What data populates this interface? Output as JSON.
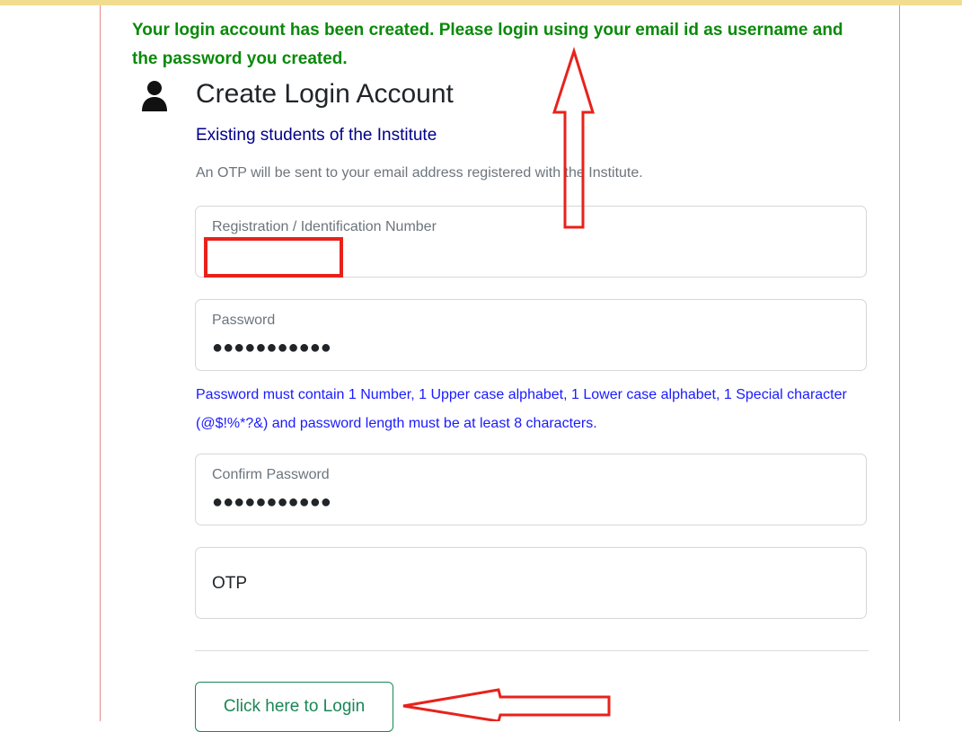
{
  "success_message": "Your login account has been created. Please login using your email id as username and the password you created.",
  "card": {
    "title": "Create Login Account",
    "subtitle": "Existing students of the Institute",
    "help_text": "An OTP will be sent to your email address registered with the Institute."
  },
  "fields": {
    "registration": {
      "label": "Registration / Identification Number"
    },
    "password": {
      "label": "Password",
      "value_masked": "●●●●●●●●●●●"
    },
    "password_rule": "Password must contain 1 Number, 1 Upper case alphabet, 1 Lower case alphabet, 1 Special character (@$!%*?&) and password length must be at least 8 characters.",
    "confirm_password": {
      "label": "Confirm Password",
      "value_masked": "●●●●●●●●●●●"
    },
    "otp": {
      "placeholder": "OTP"
    }
  },
  "login_button": {
    "label": "Click here to Login"
  },
  "colors": {
    "success_green": "#0a8a0a",
    "subtitle_blue": "#00008b",
    "rule_blue": "#1a1aff",
    "button_green": "#198754",
    "annotation_red": "#e8221b"
  }
}
